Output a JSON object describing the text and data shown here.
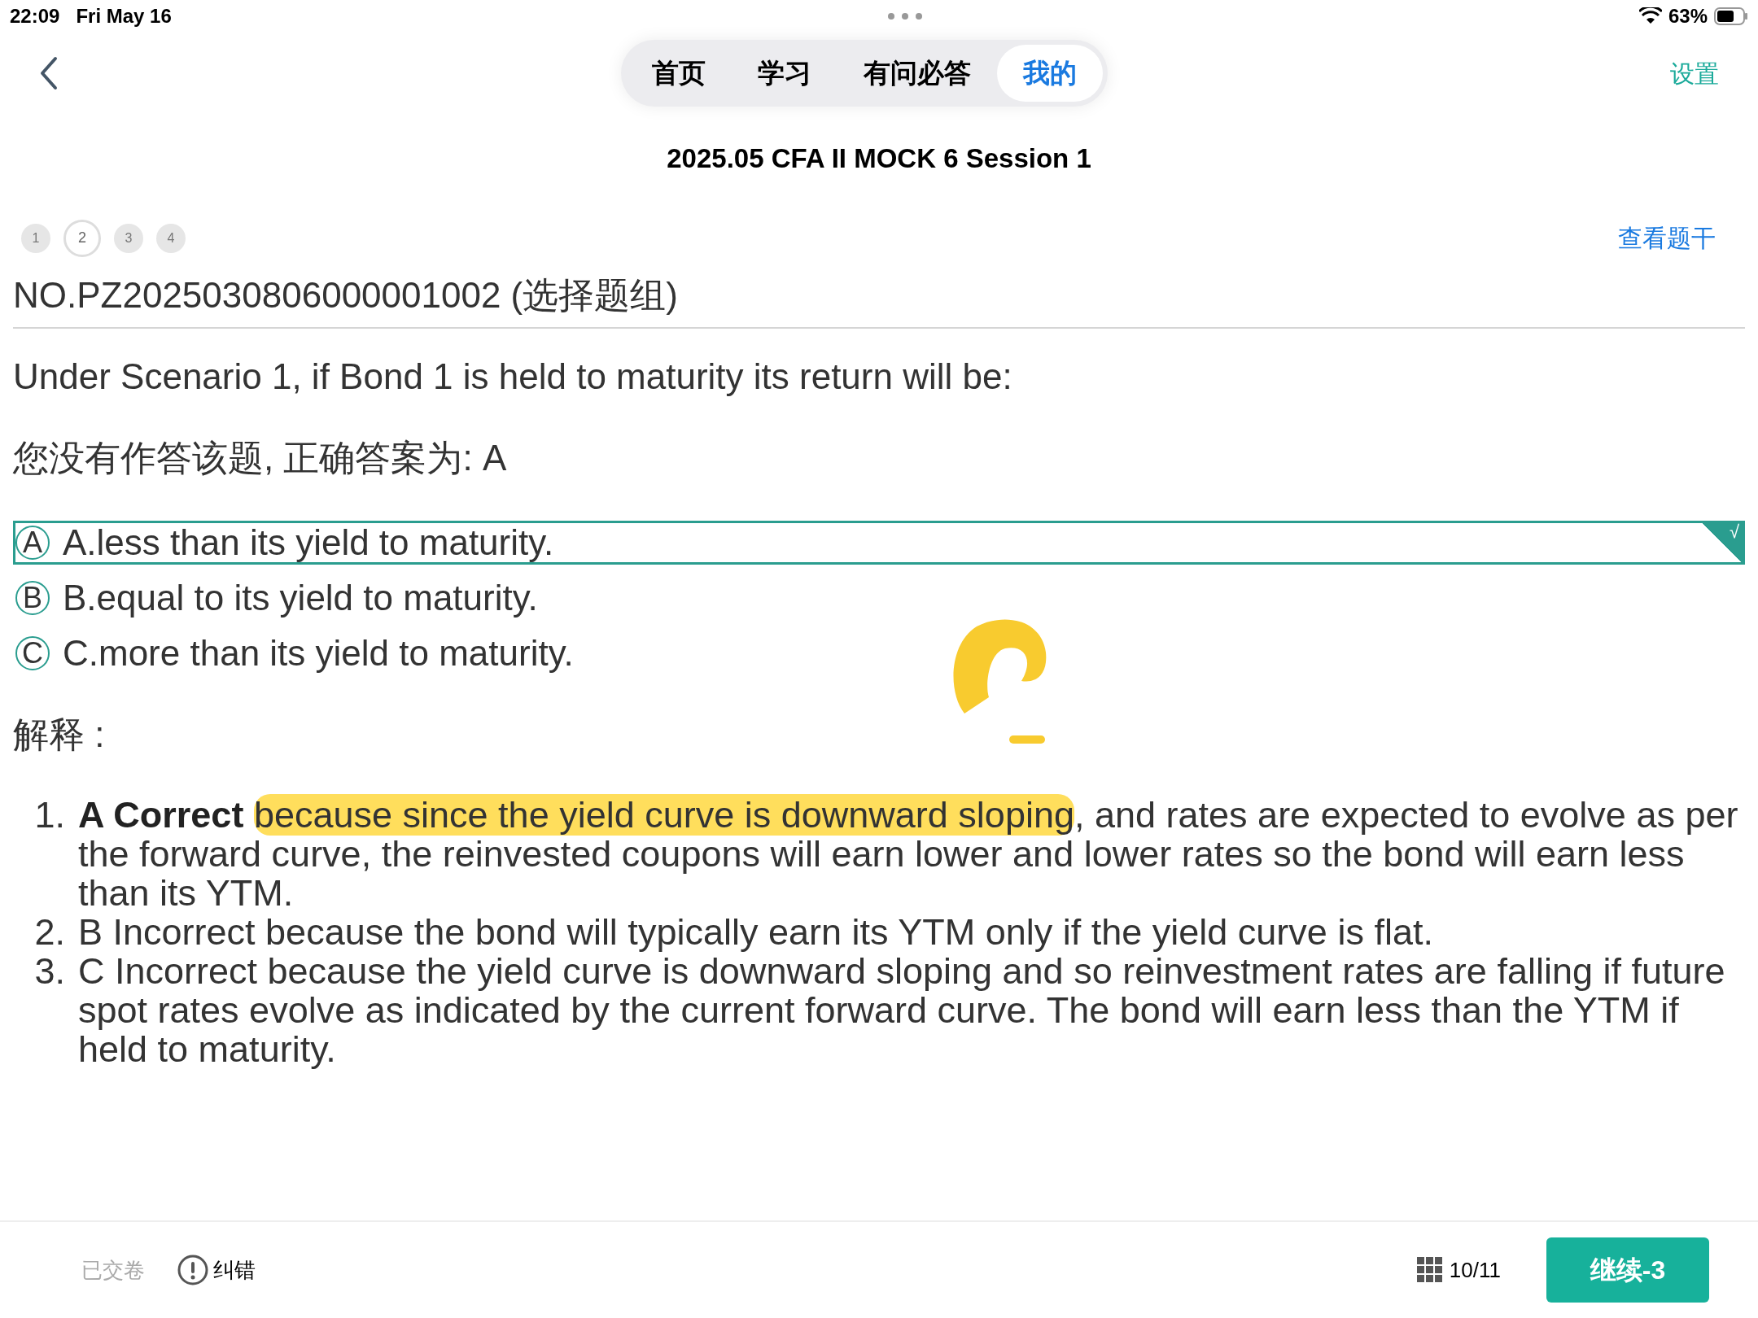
{
  "status_bar": {
    "time": "22:09",
    "date": "Fri May 16",
    "battery": "63%"
  },
  "tabs": [
    {
      "label": "首页",
      "selected": false
    },
    {
      "label": "学习",
      "selected": false
    },
    {
      "label": "有问必答",
      "selected": false
    },
    {
      "label": "我的",
      "selected": true
    }
  ],
  "settings_link": "设置",
  "title": "2025.05 CFA II MOCK 6 Session 1",
  "question_dots": [
    {
      "label": "1",
      "selected": false
    },
    {
      "label": "2",
      "selected": true
    },
    {
      "label": "3",
      "selected": false
    },
    {
      "label": "4",
      "selected": false
    }
  ],
  "view_stem_link": "查看题干",
  "question_id": "NO.PZ2025030806000001002 (选择题组)",
  "question": "Under Scenario 1, if Bond 1 is held to maturity its return will be:",
  "answer_note": "您没有作答该题, 正确答案为: A",
  "options": [
    {
      "mark": "A",
      "text": "A.less than its yield to maturity.",
      "correct": true
    },
    {
      "mark": "B",
      "text": "B.equal to its yield to maturity.",
      "correct": false
    },
    {
      "mark": "C",
      "text": "C.more than its yield to maturity.",
      "correct": false
    }
  ],
  "correct_tick": "√",
  "explanation_label": "解释 :",
  "explanation": [
    {
      "number": "1.",
      "lead": "A Correct",
      "highlighted": "because since the yield curve is downward sloping",
      "text": ", and rates are expected to evolve as per the forward curve, the reinvested coupons will earn lower and lower rates so the bond will earn less than its YTM."
    },
    {
      "number": "2.",
      "text": "B Incorrect because the bond will typically earn its YTM only if the yield curve is flat."
    },
    {
      "number": "3.",
      "text": "C Incorrect because the yield curve is downward sloping and so reinvestment rates are falling if future spot rates evolve as indicated by the current forward curve. The bond will earn less than the YTM if held to maturity."
    }
  ],
  "bottom_bar": {
    "submitted": "已交卷",
    "report": "纠错",
    "progress": "10/11",
    "continue_button": "继续-3"
  }
}
